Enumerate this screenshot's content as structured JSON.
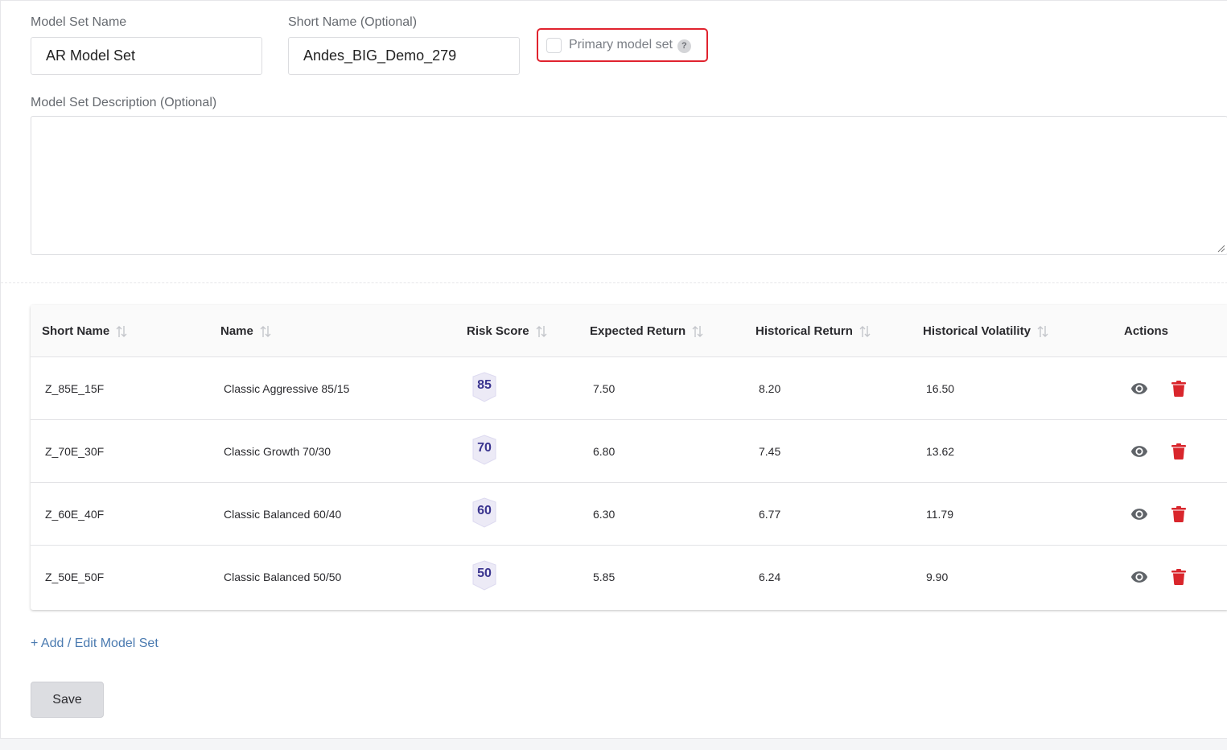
{
  "form": {
    "model_set_name_label": "Model Set Name",
    "model_set_name_value": "AR Model Set",
    "short_name_label": "Short Name (Optional)",
    "short_name_value": "Andes_BIG_Demo_279",
    "primary_label": "Primary model set",
    "primary_checked": false,
    "help_glyph": "?",
    "description_label": "Model Set Description (Optional)",
    "description_value": ""
  },
  "table": {
    "headers": {
      "short_name": "Short Name",
      "name": "Name",
      "risk_score": "Risk Score",
      "expected_return": "Expected Return",
      "historical_return": "Historical Return",
      "historical_volatility": "Historical Volatility",
      "actions": "Actions"
    },
    "rows": [
      {
        "short_name": "Z_85E_15F",
        "name": "Classic Aggressive 85/15",
        "risk_score": "85",
        "expected_return": "7.50",
        "historical_return": "8.20",
        "historical_volatility": "16.50"
      },
      {
        "short_name": "Z_70E_30F",
        "name": "Classic Growth 70/30",
        "risk_score": "70",
        "expected_return": "6.80",
        "historical_return": "7.45",
        "historical_volatility": "13.62"
      },
      {
        "short_name": "Z_60E_40F",
        "name": "Classic Balanced 60/40",
        "risk_score": "60",
        "expected_return": "6.30",
        "historical_return": "6.77",
        "historical_volatility": "11.79"
      },
      {
        "short_name": "Z_50E_50F",
        "name": "Classic Balanced 50/50",
        "risk_score": "50",
        "expected_return": "5.85",
        "historical_return": "6.24",
        "historical_volatility": "9.90"
      }
    ]
  },
  "footer": {
    "add_link": "+ Add / Edit Model Set",
    "save_label": "Save"
  },
  "colors": {
    "highlight_border": "#e0232e",
    "delete_icon": "#d9262c",
    "view_icon": "#5f6368",
    "link": "#4a7ab0",
    "risk_badge_text": "#3b3590",
    "risk_badge_fill": "#eceaf6"
  },
  "icons": {
    "sort": "sort-icon",
    "view": "eye-icon",
    "delete": "trash-icon",
    "help": "help-icon"
  }
}
